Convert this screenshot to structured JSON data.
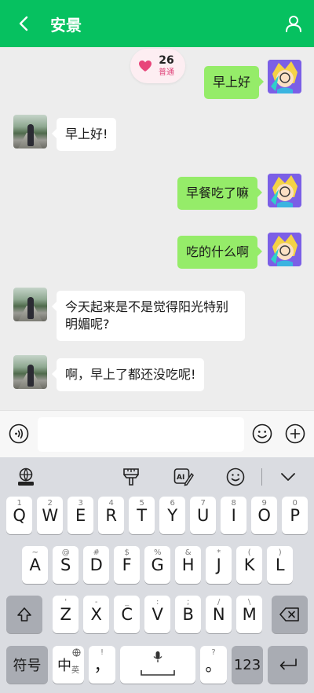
{
  "header": {
    "title": "安景"
  },
  "intimacy": {
    "score": "26",
    "level": "普通"
  },
  "messages": [
    {
      "side": "out",
      "text": "早上好"
    },
    {
      "side": "in",
      "text": "早上好!"
    },
    {
      "side": "out",
      "text": "早餐吃了嘛"
    },
    {
      "side": "out",
      "text": "吃的什么啊"
    },
    {
      "side": "in",
      "text": "今天起来是不是觉得阳光特别明媚呢?"
    },
    {
      "side": "in",
      "text": "啊，早上了都还没吃呢!"
    }
  ],
  "input": {
    "value": "",
    "placeholder": ""
  },
  "keyboard": {
    "row1": [
      {
        "key": "Q",
        "sub": "1"
      },
      {
        "key": "W",
        "sub": "2"
      },
      {
        "key": "E",
        "sub": "3"
      },
      {
        "key": "R",
        "sub": "4"
      },
      {
        "key": "T",
        "sub": "5"
      },
      {
        "key": "Y",
        "sub": "6"
      },
      {
        "key": "U",
        "sub": "7"
      },
      {
        "key": "I",
        "sub": "8"
      },
      {
        "key": "O",
        "sub": "9"
      },
      {
        "key": "P",
        "sub": "0"
      }
    ],
    "row2": [
      {
        "key": "A",
        "sub": "~"
      },
      {
        "key": "S",
        "sub": "@"
      },
      {
        "key": "D",
        "sub": "#"
      },
      {
        "key": "F",
        "sub": "$"
      },
      {
        "key": "G",
        "sub": "%"
      },
      {
        "key": "H",
        "sub": "&"
      },
      {
        "key": "J",
        "sub": "*"
      },
      {
        "key": "K",
        "sub": "("
      },
      {
        "key": "L",
        "sub": ")"
      }
    ],
    "row3": [
      {
        "key": "Z",
        "sub": "'"
      },
      {
        "key": "X",
        "sub": "-"
      },
      {
        "key": "C",
        "sub": "_"
      },
      {
        "key": "V",
        "sub": ":"
      },
      {
        "key": "B",
        "sub": ";"
      },
      {
        "key": "N",
        "sub": "/"
      },
      {
        "key": "M",
        "sub": "\\"
      }
    ],
    "symbols_label": "符号",
    "lang_label": "中",
    "lang_sub": "英",
    "comma_key": "，",
    "comma_sub": "!",
    "period_key": "。",
    "period_sub": "?",
    "numbers_label": "123"
  },
  "colors": {
    "header": "#06c160",
    "bubble_out": "#95ec69",
    "bubble_in": "#ffffff",
    "heart": "#e8457a"
  }
}
